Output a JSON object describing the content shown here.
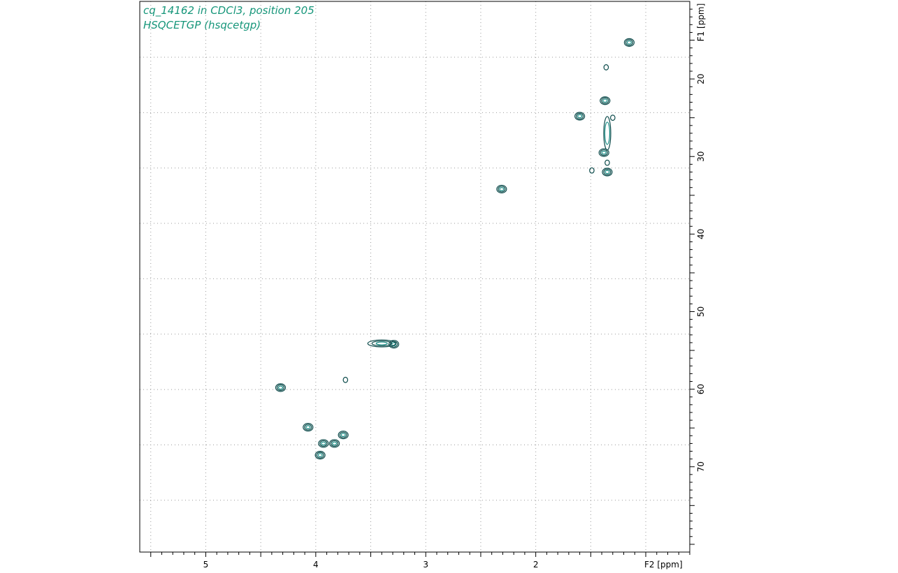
{
  "header": {
    "line1": "cq_14162 in CDCl3, position 205",
    "line2": "HSQCETGP (hsqcetgp)"
  },
  "colors": {
    "contour": "#0b4a4a",
    "contour_accent": "#168c84",
    "title_text": "#16967a",
    "grid": "#9a9a9a",
    "frame": "#000000"
  },
  "chart_data": {
    "type": "scatter",
    "title": "",
    "xlabel": "F2 [ppm]",
    "ylabel": "F1 [ppm]",
    "xlim": [
      5.6,
      0.6
    ],
    "ylim": [
      10,
      81
    ],
    "x_reversed": true,
    "y_inverted": true,
    "grid": true,
    "x_ticks": [
      5,
      4,
      3,
      2
    ],
    "x_tick_labels": [
      "5",
      "4",
      "3",
      "2"
    ],
    "y_ticks": [
      20,
      30,
      40,
      50,
      60,
      70
    ],
    "y_tick_labels": [
      "20",
      "30",
      "40",
      "50",
      "60",
      "70"
    ],
    "series": [
      {
        "points": [
          {
            "x": 1.15,
            "y": 15.3,
            "type": "oval"
          },
          {
            "x": 1.36,
            "y": 18.5,
            "type": "small"
          },
          {
            "x": 1.37,
            "y": 22.8,
            "type": "oval"
          },
          {
            "x": 1.3,
            "y": 25.0,
            "type": "small"
          },
          {
            "x": 1.6,
            "y": 24.8,
            "type": "oval"
          },
          {
            "x": 1.35,
            "y": 27.0,
            "type": "streak"
          },
          {
            "x": 1.38,
            "y": 29.5,
            "type": "oval"
          },
          {
            "x": 1.35,
            "y": 30.8,
            "type": "small"
          },
          {
            "x": 1.35,
            "y": 32.0,
            "type": "oval"
          },
          {
            "x": 1.49,
            "y": 31.8,
            "type": "small"
          },
          {
            "x": 2.31,
            "y": 34.2,
            "type": "oval"
          },
          {
            "x": 3.29,
            "y": 54.2,
            "type": "oval"
          },
          {
            "x": 3.4,
            "y": 54.1,
            "type": "tail"
          },
          {
            "x": 3.73,
            "y": 58.8,
            "type": "small"
          },
          {
            "x": 4.32,
            "y": 59.8,
            "type": "oval"
          },
          {
            "x": 4.07,
            "y": 64.9,
            "type": "oval"
          },
          {
            "x": 3.75,
            "y": 65.9,
            "type": "oval"
          },
          {
            "x": 3.93,
            "y": 67.0,
            "type": "oval"
          },
          {
            "x": 3.83,
            "y": 67.0,
            "type": "oval"
          },
          {
            "x": 3.96,
            "y": 68.5,
            "type": "oval"
          }
        ]
      }
    ]
  }
}
